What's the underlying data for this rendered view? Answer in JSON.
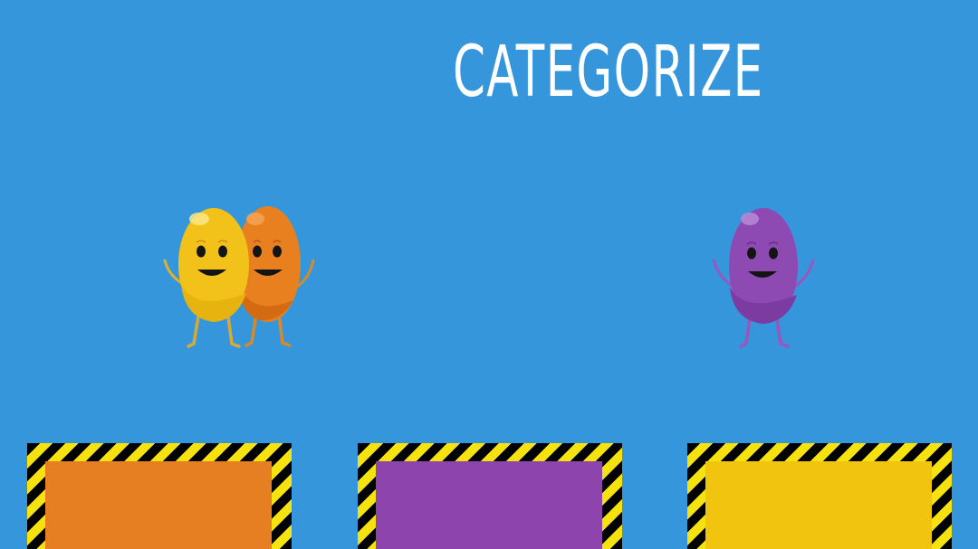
{
  "title": "CATEGORIZE",
  "characters": [
    {
      "name": "yellow-bean",
      "color": "#F2C21A"
    },
    {
      "name": "orange-bean",
      "color": "#E8801F"
    },
    {
      "name": "purple-bean",
      "color": "#8E4AB3"
    }
  ],
  "bins": [
    {
      "name": "orange-bin",
      "color": "#E67E22"
    },
    {
      "name": "purple-bin",
      "color": "#8E44AD"
    },
    {
      "name": "yellow-bin",
      "color": "#F1C40F"
    }
  ],
  "colors": {
    "background": "#3596DB",
    "stripe_black": "#000000",
    "stripe_yellow": "#F5E20E"
  }
}
